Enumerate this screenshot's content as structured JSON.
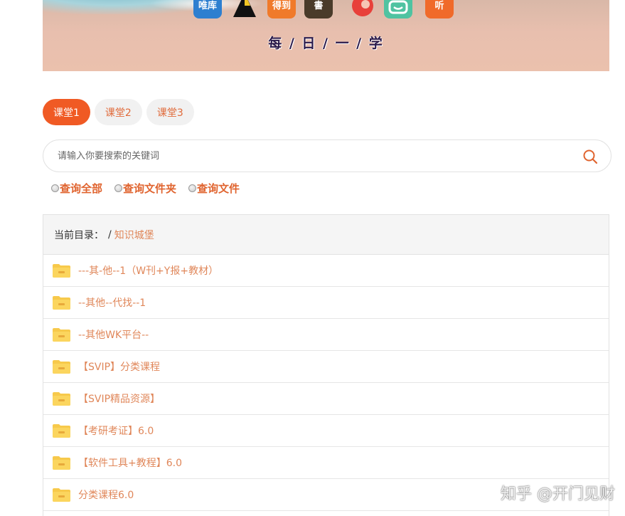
{
  "banner": {
    "motto": "每 / 日 / 一 / 学",
    "app_icons": [
      {
        "name": "weiku-app-icon",
        "text": "唯库",
        "color": "#2d7fd0"
      },
      {
        "name": "triangle-app-icon",
        "text": "",
        "color": "#f3c623"
      },
      {
        "name": "dedao-app-icon",
        "text": "得到",
        "color": "#f07a2a"
      },
      {
        "name": "book-app-icon",
        "text": "書",
        "color": "#4a3b2a"
      },
      {
        "name": "red-circle-app-icon",
        "text": "",
        "color": "#e8403a"
      },
      {
        "name": "green-chat-app-icon",
        "text": "",
        "color": "#4fc3a1"
      },
      {
        "name": "listen-app-icon",
        "text": "听",
        "color": "#f06a2a"
      }
    ]
  },
  "tabs": [
    {
      "label": "课堂1",
      "active": true
    },
    {
      "label": "课堂2",
      "active": false
    },
    {
      "label": "课堂3",
      "active": false
    }
  ],
  "search": {
    "placeholder": "请输入你要搜索的关键词",
    "value": ""
  },
  "filters": [
    {
      "label": "查询全部"
    },
    {
      "label": "查询文件夹"
    },
    {
      "label": "查询文件"
    }
  ],
  "directory": {
    "prefix": "当前目录：",
    "separator": "/",
    "current": "知识城堡",
    "items": [
      {
        "name": "---其-他--1（W刊+Y报+教材）"
      },
      {
        "name": "--其他--代找--1"
      },
      {
        "name": "--其他WK平台--"
      },
      {
        "name": "【SVIP】分类课程"
      },
      {
        "name": "【SVIP精品资源】"
      },
      {
        "name": "【考研考证】6.0"
      },
      {
        "name": "【软件工具+教程】6.0"
      },
      {
        "name": "分类课程6.0"
      }
    ]
  },
  "watermark": "知乎 @开门见财",
  "colors": {
    "accent": "#f05a24",
    "link": "#e0875a",
    "folder": "#f7c94b"
  }
}
